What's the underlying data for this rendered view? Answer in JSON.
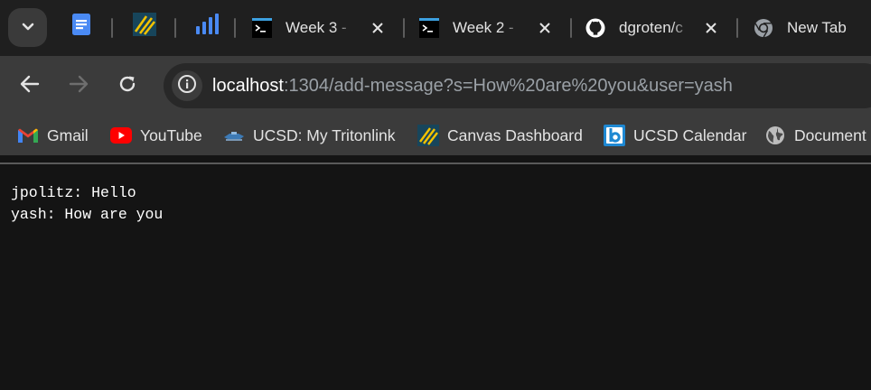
{
  "tabs": [
    {
      "title": "Week 3 - ",
      "icon": "terminal-icon"
    },
    {
      "title": "Week 2 - ",
      "icon": "terminal-icon"
    },
    {
      "title": "dgroten/c",
      "icon": "github-icon"
    },
    {
      "title": "New Tab",
      "icon": "chrome-icon"
    }
  ],
  "pinned_tabs": [
    {
      "icon": "google-docs-icon"
    },
    {
      "icon": "canvas-icon"
    },
    {
      "icon": "analytics-icon"
    }
  ],
  "address_bar": {
    "host": "localhost",
    "rest": ":1304/add-message?s=How%20are%20you&user=yash"
  },
  "bookmarks": [
    {
      "label": "Gmail",
      "icon": "gmail-icon"
    },
    {
      "label": "YouTube",
      "icon": "youtube-icon"
    },
    {
      "label": "UCSD: My Tritonlink",
      "icon": "tritonlink-icon"
    },
    {
      "label": "Canvas Dashboard",
      "icon": "canvas-icon"
    },
    {
      "label": "UCSD Calendar",
      "icon": "calendar-icon"
    },
    {
      "label": "Document",
      "icon": "globe-icon"
    }
  ],
  "page": {
    "messages": [
      "jpolitz: Hello",
      "yash: How are you"
    ]
  },
  "colors": {
    "tab_strip": "#1f1f1f",
    "toolbar": "#3b3b3b",
    "omnibox": "#282828",
    "page_background": "#141414",
    "text": "#ffffff"
  }
}
